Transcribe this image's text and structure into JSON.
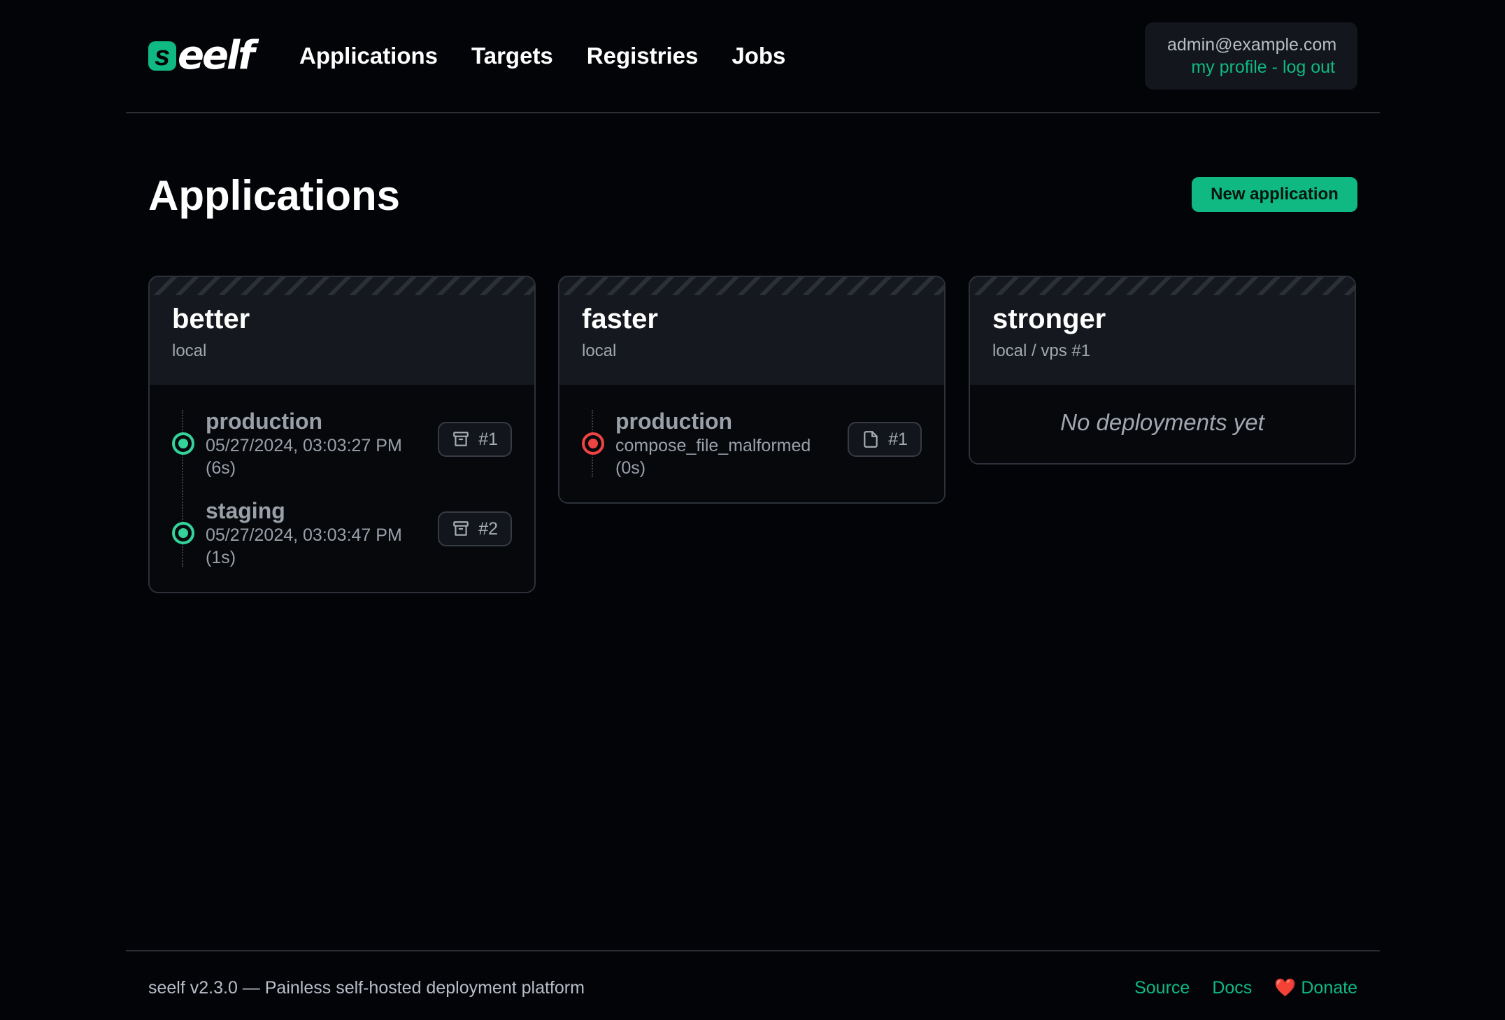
{
  "brand": {
    "logo_letter": "s",
    "logo_text": "eelf"
  },
  "nav": {
    "items": [
      "Applications",
      "Targets",
      "Registries",
      "Jobs"
    ]
  },
  "user": {
    "email": "admin@example.com",
    "profile_link": "my profile",
    "separator": "-",
    "logout_link": "log out"
  },
  "page": {
    "title": "Applications",
    "new_button": "New application"
  },
  "apps": [
    {
      "name": "better",
      "target": "local",
      "envs": [
        {
          "name": "production",
          "detail": "05/27/2024, 03:03:27 PM",
          "duration": "(6s)",
          "status": "success",
          "deploy_label": "#1",
          "icon": "archive-icon"
        },
        {
          "name": "staging",
          "detail": "05/27/2024, 03:03:47 PM",
          "duration": "(1s)",
          "status": "success",
          "deploy_label": "#2",
          "icon": "archive-icon"
        }
      ]
    },
    {
      "name": "faster",
      "target": "local",
      "envs": [
        {
          "name": "production",
          "detail": "compose_file_malformed",
          "duration": "(0s)",
          "status": "failed",
          "deploy_label": "#1",
          "icon": "file-icon"
        }
      ]
    },
    {
      "name": "stronger",
      "target": "local / vps #1",
      "empty_text": "No deployments yet"
    }
  ],
  "footer": {
    "text": "seelf v2.3.0 — Painless self-hosted deployment platform",
    "source": "Source",
    "docs": "Docs",
    "donate_icon": "❤️",
    "donate": "Donate"
  },
  "colors": {
    "accent": "#10b981",
    "success": "#34d399",
    "error": "#ef4444",
    "background": "#030408"
  }
}
